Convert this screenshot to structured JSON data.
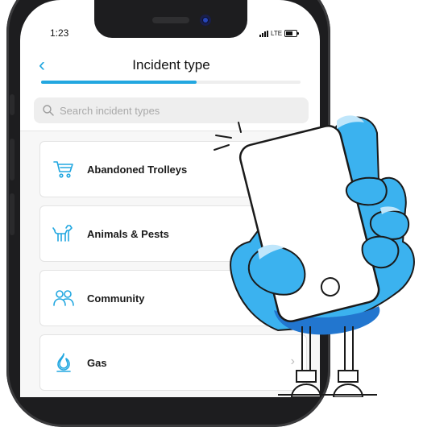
{
  "status": {
    "time": "1:23",
    "network": "LTE"
  },
  "header": {
    "title": "Incident type",
    "progress_fraction": 0.6
  },
  "search": {
    "placeholder": "Search incident types"
  },
  "incident_types": [
    {
      "label": "Abandoned Trolleys",
      "icon": "shopping-cart-icon"
    },
    {
      "label": "Animals & Pests",
      "icon": "dog-icon"
    },
    {
      "label": "Community",
      "icon": "people-icon"
    },
    {
      "label": "Gas",
      "icon": "flame-icon"
    }
  ],
  "colors": {
    "accent": "#22a7e0",
    "hand_blue": "#3bb2ef",
    "hand_shadow": "#2276cf"
  }
}
